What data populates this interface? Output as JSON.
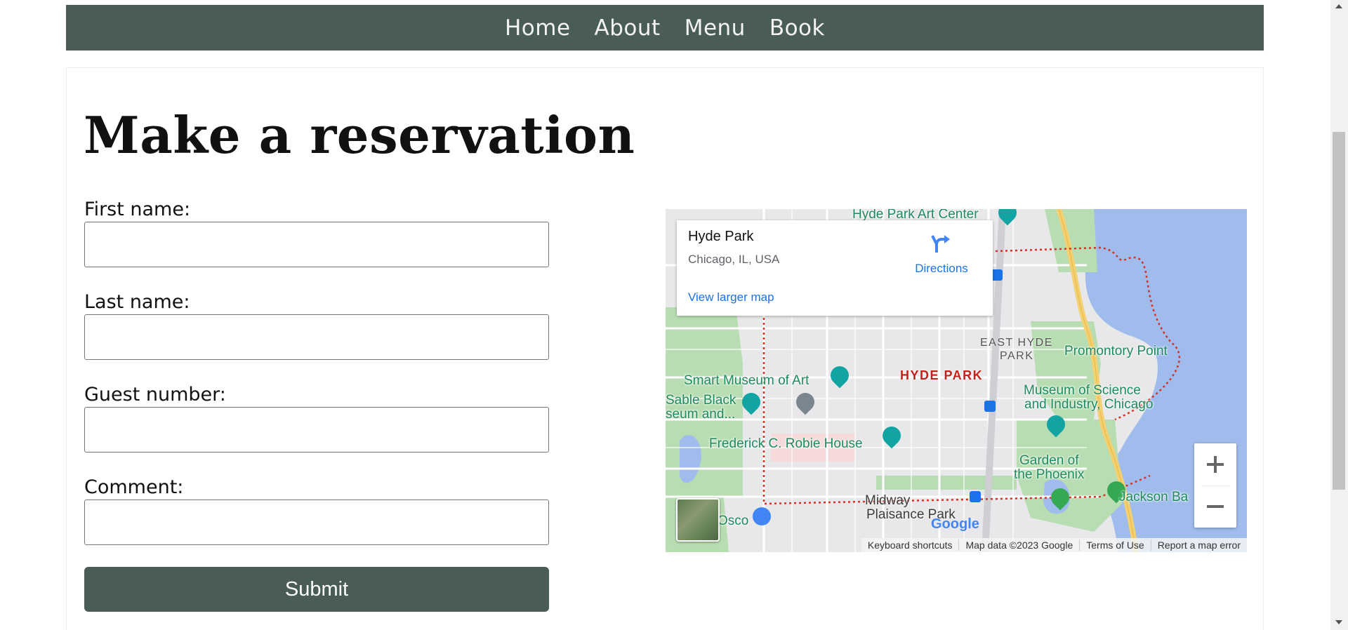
{
  "nav": {
    "items": [
      "Home",
      "About",
      "Menu",
      "Book"
    ]
  },
  "page": {
    "title": "Make a reservation"
  },
  "form": {
    "first_name_label": "First name:",
    "last_name_label": "Last name:",
    "guest_number_label": "Guest number:",
    "comment_label": "Comment:",
    "first_name_value": "",
    "last_name_value": "",
    "guest_number_value": "",
    "comment_value": "",
    "submit_label": "Submit"
  },
  "map": {
    "place_name": "Hyde Park",
    "place_address": "Chicago, IL, USA",
    "directions_label": "Directions",
    "view_larger_label": "View larger map",
    "zoom_in_icon": "plus-icon",
    "zoom_out_icon": "minus-icon",
    "labels": {
      "hyde_park_art_center": "Hyde Park Art Center",
      "east_hyde_park_line1": "EAST HYDE",
      "east_hyde_park_line2": "PARK",
      "hyde_park": "HYDE PARK",
      "promontory_point": "Promontory Point",
      "smart_museum": "Smart Museum of Art",
      "sable_black_line1": "Sable Black",
      "sable_black_line2": "seum and...",
      "museum_science_line1": "Museum of Science",
      "museum_science_line2": "and Industry, Chicago",
      "robie_house": "Frederick C. Robie House",
      "garden_phoenix_line1": "Garden of",
      "garden_phoenix_line2": "the Phoenix",
      "midway_line1": "Midway",
      "midway_line2": "Plaisance Park",
      "jackson_park": "Jackson Ba",
      "osco": "Osco",
      "google_logo": "Google"
    },
    "attribution": {
      "keyboard": "Keyboard shortcuts",
      "map_data": "Map data ©2023 Google",
      "terms": "Terms of Use",
      "report": "Report a map error"
    },
    "colors": {
      "water": "#9fbcec",
      "park": "#b8ddb2",
      "land": "#e8e8ea",
      "highway": "#f3d173"
    }
  },
  "colors": {
    "nav_bg": "#4a5d55",
    "button_bg": "#4a5d55",
    "link": "#1a73e8"
  }
}
